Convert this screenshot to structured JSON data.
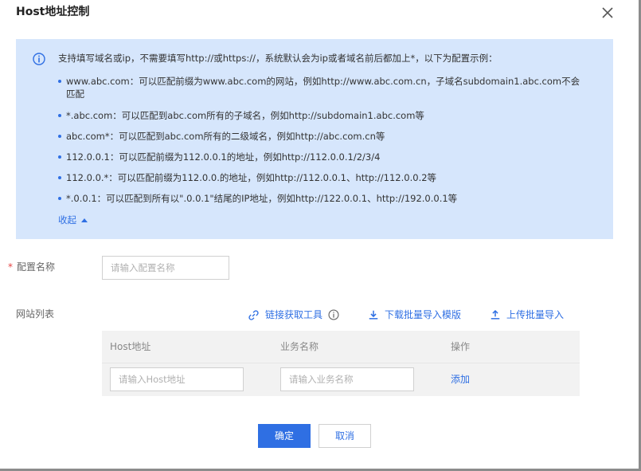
{
  "dialog": {
    "title": "Host地址控制",
    "close_icon": "close-icon"
  },
  "notice": {
    "icon": "info-icon",
    "color": "#2f6fe3",
    "background": "#d6e6fc",
    "heading": "支持填写域名或ip，不需要填写http://或https://，系统默认会为ip或者域名前后都加上*，以下为配置示例：",
    "items": [
      "www.abc.com：可以匹配前缀为www.abc.com的网站，例如http://www.abc.com.cn，子域名subdomain1.abc.com不会匹配",
      "*.abc.com：可以匹配到abc.com所有的子域名，例如http://subdomain1.abc.com等",
      "abc.com*：可以匹配到abc.com所有的二级域名，例如http://abc.com.cn等",
      "112.0.0.1：可以匹配前缀为112.0.0.1的地址，例如http://112.0.0.1/2/3/4",
      "112.0.0.*：可以匹配前缀为112.0.0.的地址，例如http://112.0.0.1、http://112.0.0.2等",
      "*.0.0.1：可以匹配到所有以\".0.0.1\"结尾的IP地址，例如http://122.0.0.1、http://192.0.0.1等"
    ],
    "collapse_label": "收起"
  },
  "form": {
    "config_name": {
      "required_mark": "*",
      "label": "配置名称",
      "placeholder": "请输入配置名称",
      "value": ""
    },
    "site_list": {
      "label": "网站列表",
      "tools": {
        "link_tool_label": "链接获取工具",
        "download_template_label": "下载批量导入模版",
        "upload_import_label": "上传批量导入"
      },
      "table": {
        "columns": [
          "Host地址",
          "业务名称",
          "操作"
        ],
        "host_placeholder": "请输入Host地址",
        "business_placeholder": "请输入业务名称",
        "add_label": "添加"
      }
    }
  },
  "footer": {
    "confirm_label": "确定",
    "cancel_label": "取消"
  }
}
